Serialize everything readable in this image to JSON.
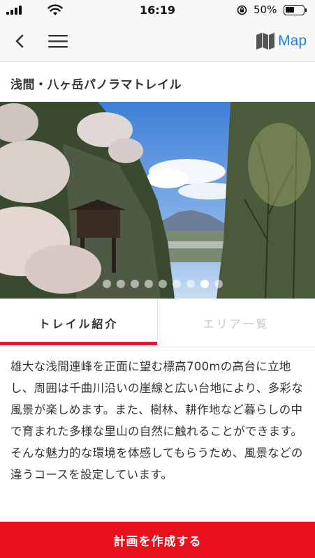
{
  "status_bar": {
    "time": "16:19",
    "battery_percent": "50%",
    "battery_level": 0.5,
    "icons": [
      "signal-icon",
      "wifi-icon",
      "rotation-lock-icon",
      "battery-icon"
    ]
  },
  "nav_bar": {
    "map_label": "Map",
    "icons": [
      "back-chevron-icon",
      "hamburger-menu-icon",
      "map-icon"
    ],
    "accent_color": "#1f7fd6"
  },
  "page": {
    "title": "浅間・八ヶ岳パノラマトレイル"
  },
  "carousel": {
    "slide_count": 9,
    "active_index": 7
  },
  "tabs": [
    {
      "label": "トレイル紹介",
      "active": true
    },
    {
      "label": "エリア一覧",
      "active": false
    }
  ],
  "description": "雄大な浅間連峰を正面に望む標高700mの高台に立地し、周囲は千曲川沿いの崖線と広い台地により、多彩な風景が楽しめます。また、樹林、耕作地など暮らしの中で育まれた多様な里山の自然に触れることができます。そんな魅力的な環境を体感してもらうため、風景などの違うコースを設定しています。",
  "cta": {
    "label": "計画を作成する",
    "color": "#e8101d"
  }
}
